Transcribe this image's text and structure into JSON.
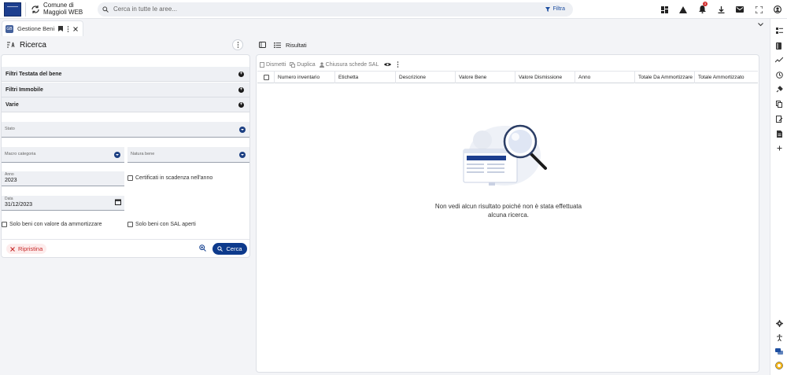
{
  "topbar": {
    "app_name": "Comune di Maggioli WEB",
    "search_placeholder": "Cerca in tutte le aree...",
    "filter_label": "Filtra",
    "notification_count": "3"
  },
  "tabs": [
    {
      "label": "Gestione Beni",
      "icon_text": "GB"
    }
  ],
  "left_panel": {
    "title": "Ricerca",
    "filter_sections": [
      {
        "label": "Filtri Testata del bene"
      },
      {
        "label": "Filtri Immobile"
      },
      {
        "label": "Varie"
      }
    ],
    "fields": {
      "stato": {
        "label": "Stato",
        "value": ""
      },
      "macro_categoria": {
        "label": "Macro categoria",
        "value": ""
      },
      "natura_bene": {
        "label": "Natura bene",
        "value": ""
      },
      "anno": {
        "label": "Anno",
        "value": "2023"
      },
      "data": {
        "label": "Data",
        "value": "31/12/2023"
      }
    },
    "checkboxes": {
      "certificati": "Certificati in scadenza nell'anno",
      "solo_valore": "Solo beni con valore da ammortizzare",
      "solo_sal": "Solo beni con SAL aperti"
    },
    "reset_label": "Ripristina",
    "search_label": "Cerca"
  },
  "main": {
    "title": "Risultati",
    "toolbar": {
      "dismetti": "Dismetti",
      "duplica": "Duplica",
      "chiusura": "Chiusura schede SAL"
    },
    "columns": [
      "Numero inventario",
      "Etichetta",
      "Descrizione",
      "Valore Bene",
      "Valore Dismissione",
      "Anno",
      "Totale Da Ammortizzare",
      "Totale Ammortizzato"
    ],
    "empty_message": "Non vedi alcun risultato poiché non è stata effettuata alcuna ricerca."
  },
  "colors": {
    "primary": "#0d3a8c",
    "danger": "#c62828",
    "background": "#f3f4f7"
  }
}
